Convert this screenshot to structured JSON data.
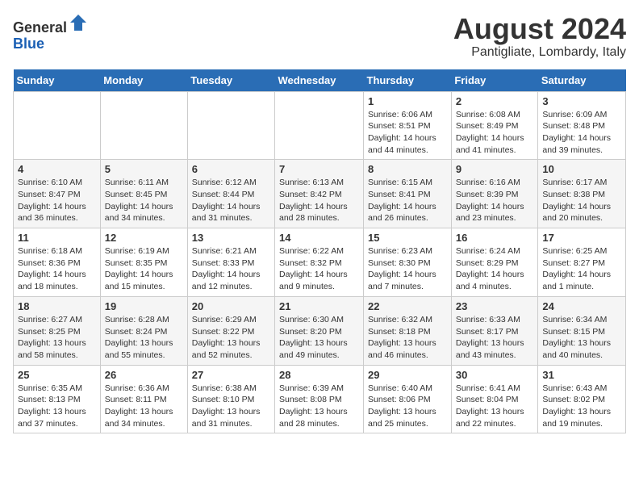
{
  "header": {
    "logo_line1": "General",
    "logo_line2": "Blue",
    "month_title": "August 2024",
    "location": "Pantigliate, Lombardy, Italy"
  },
  "days_of_week": [
    "Sunday",
    "Monday",
    "Tuesday",
    "Wednesday",
    "Thursday",
    "Friday",
    "Saturday"
  ],
  "weeks": [
    [
      {
        "day": "",
        "info": ""
      },
      {
        "day": "",
        "info": ""
      },
      {
        "day": "",
        "info": ""
      },
      {
        "day": "",
        "info": ""
      },
      {
        "day": "1",
        "info": "Sunrise: 6:06 AM\nSunset: 8:51 PM\nDaylight: 14 hours and 44 minutes."
      },
      {
        "day": "2",
        "info": "Sunrise: 6:08 AM\nSunset: 8:49 PM\nDaylight: 14 hours and 41 minutes."
      },
      {
        "day": "3",
        "info": "Sunrise: 6:09 AM\nSunset: 8:48 PM\nDaylight: 14 hours and 39 minutes."
      }
    ],
    [
      {
        "day": "4",
        "info": "Sunrise: 6:10 AM\nSunset: 8:47 PM\nDaylight: 14 hours and 36 minutes."
      },
      {
        "day": "5",
        "info": "Sunrise: 6:11 AM\nSunset: 8:45 PM\nDaylight: 14 hours and 34 minutes."
      },
      {
        "day": "6",
        "info": "Sunrise: 6:12 AM\nSunset: 8:44 PM\nDaylight: 14 hours and 31 minutes."
      },
      {
        "day": "7",
        "info": "Sunrise: 6:13 AM\nSunset: 8:42 PM\nDaylight: 14 hours and 28 minutes."
      },
      {
        "day": "8",
        "info": "Sunrise: 6:15 AM\nSunset: 8:41 PM\nDaylight: 14 hours and 26 minutes."
      },
      {
        "day": "9",
        "info": "Sunrise: 6:16 AM\nSunset: 8:39 PM\nDaylight: 14 hours and 23 minutes."
      },
      {
        "day": "10",
        "info": "Sunrise: 6:17 AM\nSunset: 8:38 PM\nDaylight: 14 hours and 20 minutes."
      }
    ],
    [
      {
        "day": "11",
        "info": "Sunrise: 6:18 AM\nSunset: 8:36 PM\nDaylight: 14 hours and 18 minutes."
      },
      {
        "day": "12",
        "info": "Sunrise: 6:19 AM\nSunset: 8:35 PM\nDaylight: 14 hours and 15 minutes."
      },
      {
        "day": "13",
        "info": "Sunrise: 6:21 AM\nSunset: 8:33 PM\nDaylight: 14 hours and 12 minutes."
      },
      {
        "day": "14",
        "info": "Sunrise: 6:22 AM\nSunset: 8:32 PM\nDaylight: 14 hours and 9 minutes."
      },
      {
        "day": "15",
        "info": "Sunrise: 6:23 AM\nSunset: 8:30 PM\nDaylight: 14 hours and 7 minutes."
      },
      {
        "day": "16",
        "info": "Sunrise: 6:24 AM\nSunset: 8:29 PM\nDaylight: 14 hours and 4 minutes."
      },
      {
        "day": "17",
        "info": "Sunrise: 6:25 AM\nSunset: 8:27 PM\nDaylight: 14 hours and 1 minute."
      }
    ],
    [
      {
        "day": "18",
        "info": "Sunrise: 6:27 AM\nSunset: 8:25 PM\nDaylight: 13 hours and 58 minutes."
      },
      {
        "day": "19",
        "info": "Sunrise: 6:28 AM\nSunset: 8:24 PM\nDaylight: 13 hours and 55 minutes."
      },
      {
        "day": "20",
        "info": "Sunrise: 6:29 AM\nSunset: 8:22 PM\nDaylight: 13 hours and 52 minutes."
      },
      {
        "day": "21",
        "info": "Sunrise: 6:30 AM\nSunset: 8:20 PM\nDaylight: 13 hours and 49 minutes."
      },
      {
        "day": "22",
        "info": "Sunrise: 6:32 AM\nSunset: 8:18 PM\nDaylight: 13 hours and 46 minutes."
      },
      {
        "day": "23",
        "info": "Sunrise: 6:33 AM\nSunset: 8:17 PM\nDaylight: 13 hours and 43 minutes."
      },
      {
        "day": "24",
        "info": "Sunrise: 6:34 AM\nSunset: 8:15 PM\nDaylight: 13 hours and 40 minutes."
      }
    ],
    [
      {
        "day": "25",
        "info": "Sunrise: 6:35 AM\nSunset: 8:13 PM\nDaylight: 13 hours and 37 minutes."
      },
      {
        "day": "26",
        "info": "Sunrise: 6:36 AM\nSunset: 8:11 PM\nDaylight: 13 hours and 34 minutes."
      },
      {
        "day": "27",
        "info": "Sunrise: 6:38 AM\nSunset: 8:10 PM\nDaylight: 13 hours and 31 minutes."
      },
      {
        "day": "28",
        "info": "Sunrise: 6:39 AM\nSunset: 8:08 PM\nDaylight: 13 hours and 28 minutes."
      },
      {
        "day": "29",
        "info": "Sunrise: 6:40 AM\nSunset: 8:06 PM\nDaylight: 13 hours and 25 minutes."
      },
      {
        "day": "30",
        "info": "Sunrise: 6:41 AM\nSunset: 8:04 PM\nDaylight: 13 hours and 22 minutes."
      },
      {
        "day": "31",
        "info": "Sunrise: 6:43 AM\nSunset: 8:02 PM\nDaylight: 13 hours and 19 minutes."
      }
    ]
  ]
}
